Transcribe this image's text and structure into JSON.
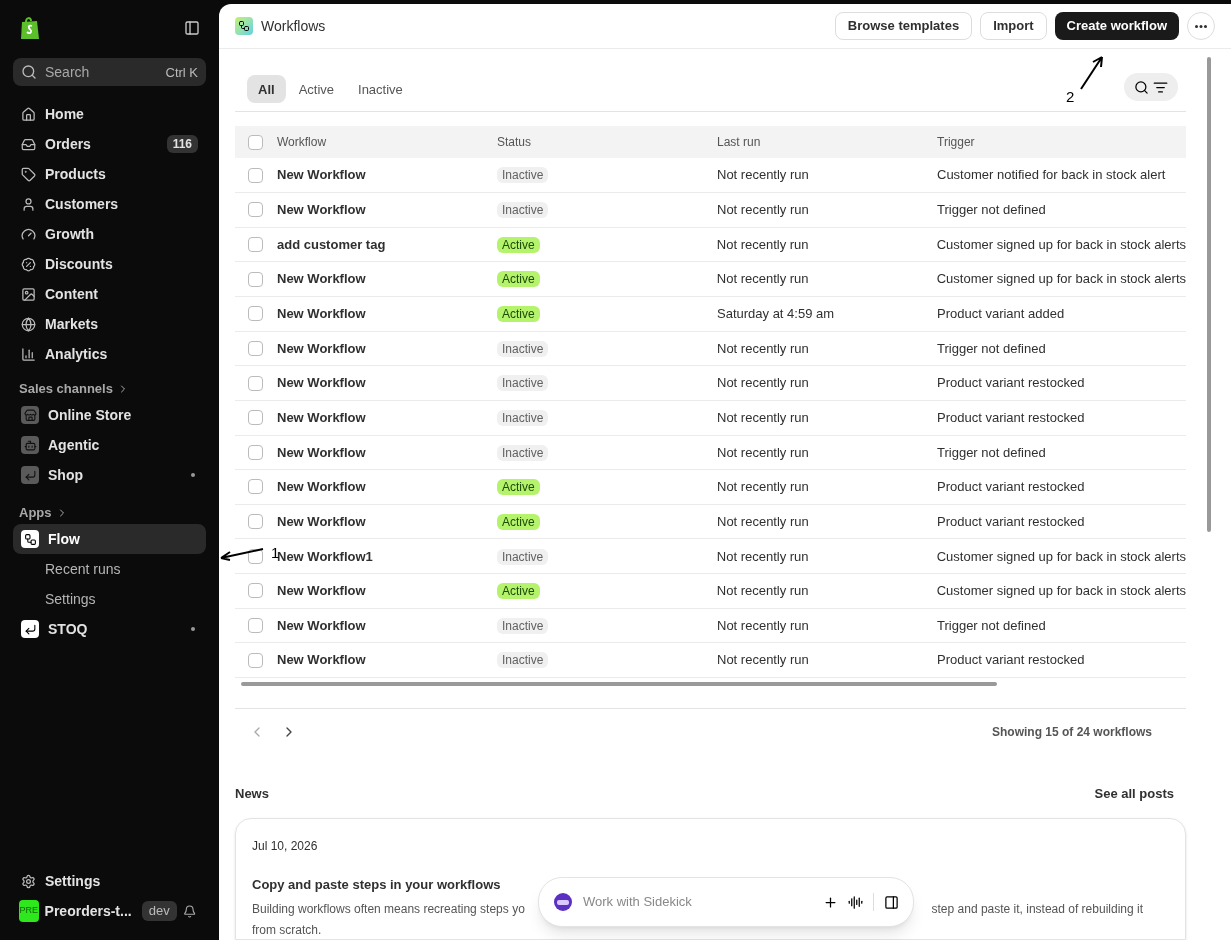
{
  "sidebar": {
    "search": {
      "placeholder": "Search",
      "shortcut": "Ctrl K"
    },
    "items": [
      {
        "label": "Home"
      },
      {
        "label": "Orders",
        "count": "116"
      },
      {
        "label": "Products"
      },
      {
        "label": "Customers"
      },
      {
        "label": "Growth"
      },
      {
        "label": "Discounts"
      },
      {
        "label": "Content"
      },
      {
        "label": "Markets"
      },
      {
        "label": "Analytics"
      }
    ],
    "sales_channels": {
      "heading": "Sales channels",
      "items": [
        {
          "label": "Online Store",
          "dot": false
        },
        {
          "label": "Agentic",
          "dot": false
        },
        {
          "label": "Shop",
          "dot": true
        }
      ]
    },
    "apps": {
      "heading": "Apps",
      "items": [
        {
          "label": "Flow",
          "selected": true,
          "dot": false,
          "children": [
            {
              "label": "Recent runs"
            },
            {
              "label": "Settings"
            }
          ]
        },
        {
          "label": "STOQ",
          "selected": false,
          "dot": true
        }
      ]
    },
    "settings": "Settings",
    "store": {
      "avatar": "PRE",
      "name": "Preorders-t...",
      "badge": "dev"
    }
  },
  "header": {
    "title": "Workflows",
    "buttons": [
      {
        "label": "Browse templates",
        "kind": "secondary"
      },
      {
        "label": "Import",
        "kind": "secondary"
      },
      {
        "label": "Create workflow",
        "kind": "primary"
      }
    ]
  },
  "tabs": [
    {
      "label": "All",
      "selected": true
    },
    {
      "label": "Active",
      "selected": false
    },
    {
      "label": "Inactive",
      "selected": false
    }
  ],
  "table": {
    "select_all_checked": false,
    "columns": [
      "Workflow",
      "Status",
      "Last run",
      "Trigger"
    ],
    "rows": [
      {
        "checked": false,
        "name": "New Workflow",
        "status": "Inactive",
        "active": false,
        "last_run": "Not recently run",
        "trigger": "Customer notified for back in stock alert"
      },
      {
        "checked": false,
        "name": "New Workflow",
        "status": "Inactive",
        "active": false,
        "last_run": "Not recently run",
        "trigger": "Trigger not defined"
      },
      {
        "checked": false,
        "name": "add customer tag",
        "status": "Active",
        "active": true,
        "last_run": "Not recently run",
        "trigger": "Customer signed up for back in stock alerts"
      },
      {
        "checked": false,
        "name": "New Workflow",
        "status": "Active",
        "active": true,
        "last_run": "Not recently run",
        "trigger": "Customer signed up for back in stock alerts"
      },
      {
        "checked": false,
        "name": "New Workflow",
        "status": "Active",
        "active": true,
        "last_run": "Saturday at 4:59 am",
        "trigger": "Product variant added"
      },
      {
        "checked": false,
        "name": "New Workflow",
        "status": "Inactive",
        "active": false,
        "last_run": "Not recently run",
        "trigger": "Trigger not defined"
      },
      {
        "checked": false,
        "name": "New Workflow",
        "status": "Inactive",
        "active": false,
        "last_run": "Not recently run",
        "trigger": "Product variant restocked"
      },
      {
        "checked": false,
        "name": "New Workflow",
        "status": "Inactive",
        "active": false,
        "last_run": "Not recently run",
        "trigger": "Product variant restocked"
      },
      {
        "checked": false,
        "name": "New Workflow",
        "status": "Inactive",
        "active": false,
        "last_run": "Not recently run",
        "trigger": "Trigger not defined"
      },
      {
        "checked": false,
        "name": "New Workflow",
        "status": "Active",
        "active": true,
        "last_run": "Not recently run",
        "trigger": "Product variant restocked"
      },
      {
        "checked": false,
        "name": "New Workflow",
        "status": "Active",
        "active": true,
        "last_run": "Not recently run",
        "trigger": "Product variant restocked"
      },
      {
        "checked": false,
        "name": "New Workflow1",
        "status": "Inactive",
        "active": false,
        "last_run": "Not recently run",
        "trigger": "Customer signed up for back in stock alerts"
      },
      {
        "checked": false,
        "name": "New Workflow",
        "status": "Active",
        "active": true,
        "last_run": "Not recently run",
        "trigger": "Customer signed up for back in stock alerts"
      },
      {
        "checked": false,
        "name": "New Workflow",
        "status": "Inactive",
        "active": false,
        "last_run": "Not recently run",
        "trigger": "Trigger not defined"
      },
      {
        "checked": false,
        "name": "New Workflow",
        "status": "Inactive",
        "active": false,
        "last_run": "Not recently run",
        "trigger": "Product variant restocked"
      }
    ],
    "footer": "Showing 15 of 24 workflows"
  },
  "news": {
    "heading": "News",
    "link": "See all posts",
    "post": {
      "date": "Jul 10, 2026",
      "title": "Copy and paste steps in your workflows",
      "body_start": "Building workflows often means recreating steps yo",
      "body_end": "step and paste it, instead of rebuilding it",
      "body_last": "from scratch."
    }
  },
  "sidekick": {
    "placeholder": "Work with Sidekick"
  },
  "annotations": [
    {
      "label": "1"
    },
    {
      "label": "2"
    }
  ]
}
